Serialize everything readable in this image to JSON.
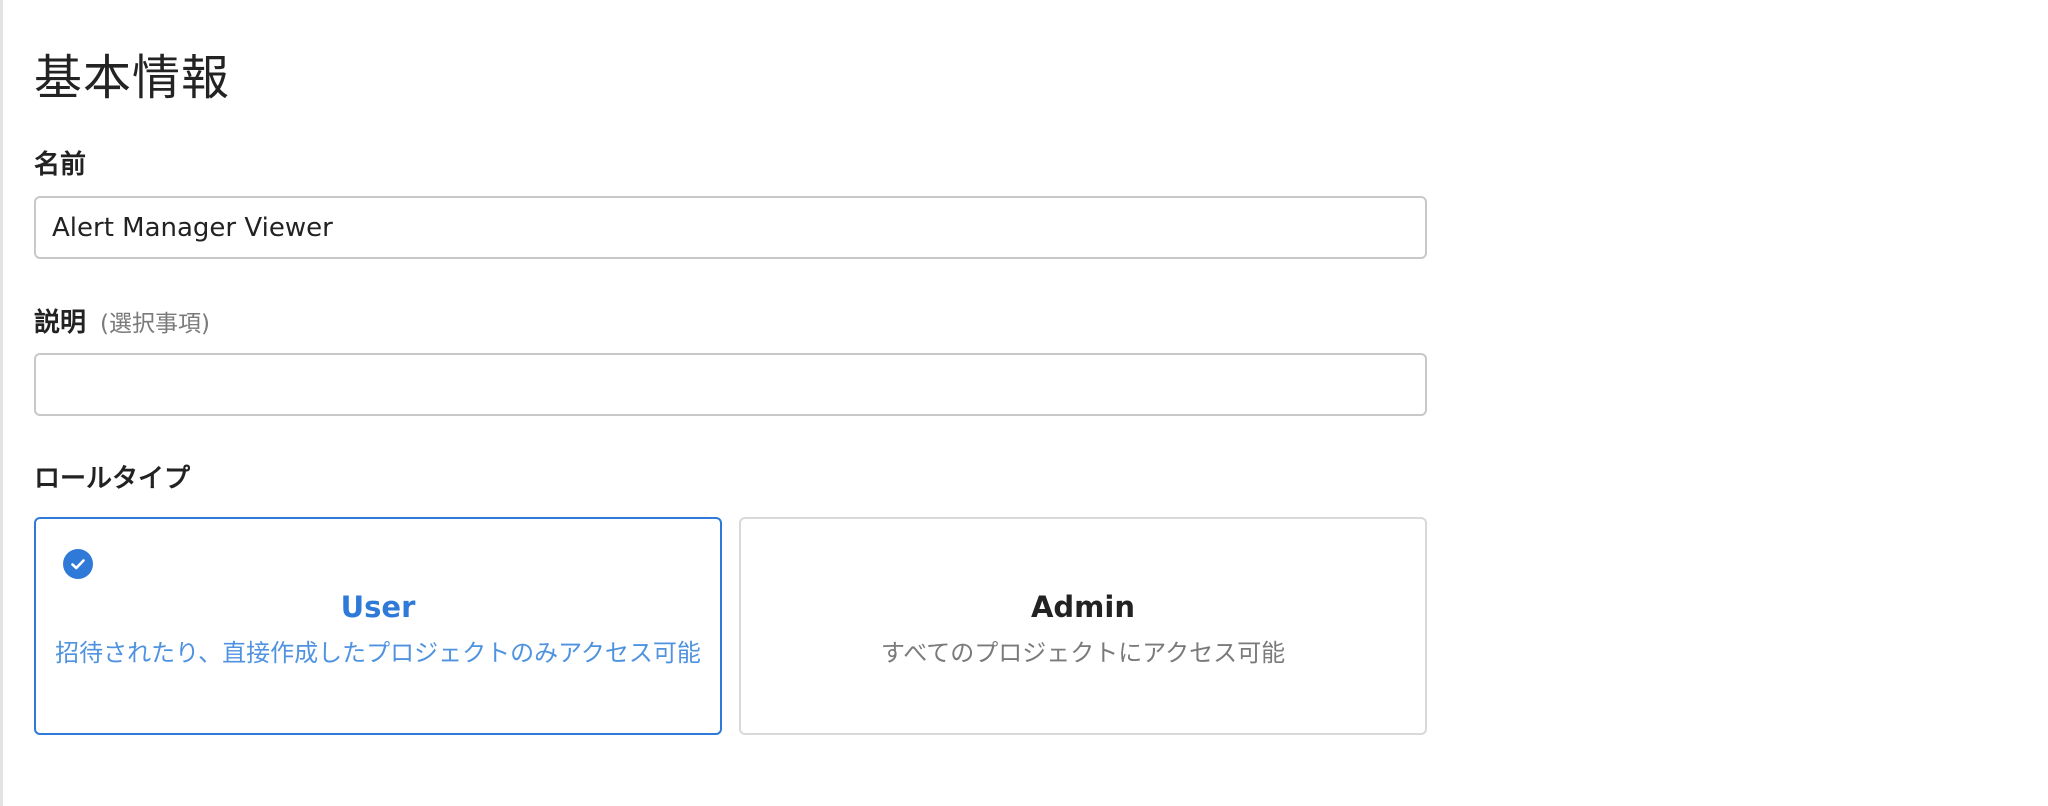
{
  "section": {
    "title": "基本情報"
  },
  "name_field": {
    "label": "名前",
    "value": "Alert Manager Viewer",
    "placeholder": ""
  },
  "description_field": {
    "label": "説明",
    "optional_note": "(選択事項)",
    "value": "",
    "placeholder": ""
  },
  "role_type": {
    "label": "ロールタイプ",
    "options": [
      {
        "name": "User",
        "description": "招待されたり、直接作成したプロジェクトのみアクセス可能",
        "selected": true
      },
      {
        "name": "Admin",
        "description": "すべてのプロジェクトにアクセス可能",
        "selected": false
      }
    ]
  },
  "colors": {
    "accent": "#2f7ad9",
    "border": "#c8c8c8"
  },
  "icons": {
    "selected_indicator": "check-circle-icon"
  }
}
